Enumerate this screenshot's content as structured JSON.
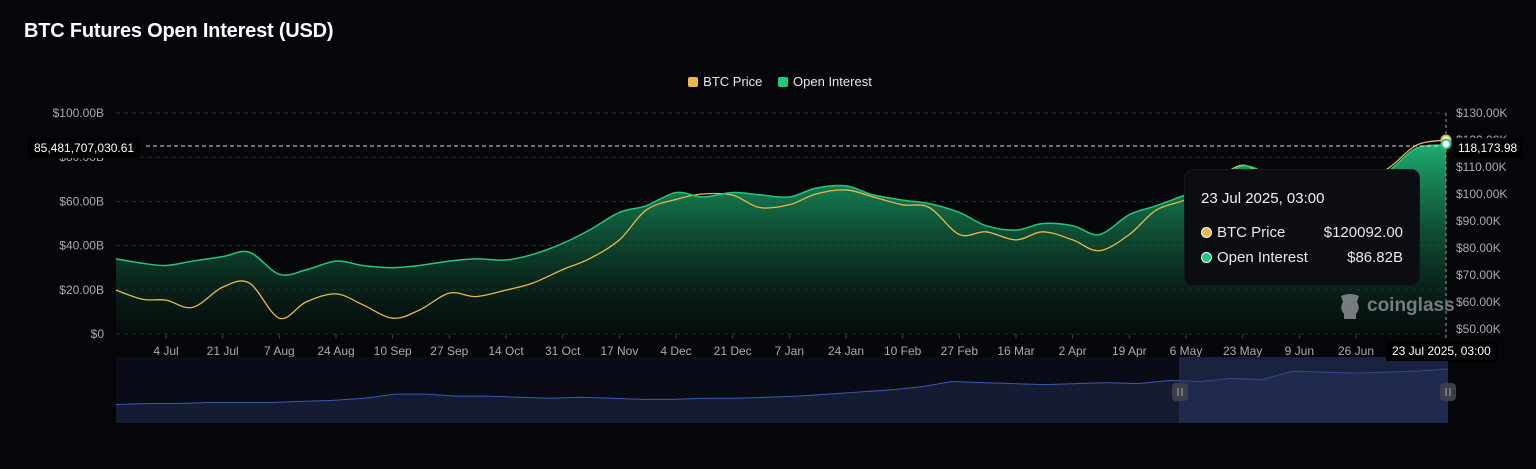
{
  "title": "BTC Futures Open Interest (USD)",
  "legend": [
    {
      "name": "BTC Price",
      "color": "#e8b84a"
    },
    {
      "name": "Open Interest",
      "color": "#21c77f"
    }
  ],
  "tooltip": {
    "date": "23 Jul 2025, 03:00",
    "rows": [
      {
        "name": "BTC Price",
        "value": "$120092.00",
        "color": "#e8b84a"
      },
      {
        "name": "Open Interest",
        "value": "$86.82B",
        "color": "#21c77f"
      }
    ]
  },
  "crosshair": {
    "left_value": "85,481,707,030.61",
    "right_value": "118,173.98",
    "x_label": "23 Jul 2025, 03:00"
  },
  "watermark": "coinglass",
  "chart_data": {
    "type": "line",
    "title": "BTC Futures Open Interest (USD)",
    "x": [
      "2024-06-19",
      "2024-06-27",
      "2024-07-04",
      "2024-07-12",
      "2024-07-21",
      "2024-07-29",
      "2024-08-07",
      "2024-08-15",
      "2024-08-24",
      "2024-09-01",
      "2024-09-10",
      "2024-09-18",
      "2024-09-27",
      "2024-10-05",
      "2024-10-14",
      "2024-10-22",
      "2024-10-31",
      "2024-11-08",
      "2024-11-17",
      "2024-11-25",
      "2024-12-04",
      "2024-12-12",
      "2024-12-21",
      "2024-12-29",
      "2025-01-07",
      "2025-01-15",
      "2025-01-24",
      "2025-02-01",
      "2025-02-10",
      "2025-02-18",
      "2025-02-27",
      "2025-03-07",
      "2025-03-16",
      "2025-03-24",
      "2025-04-02",
      "2025-04-10",
      "2025-04-19",
      "2025-04-27",
      "2025-05-06",
      "2025-05-14",
      "2025-05-23",
      "2025-06-01",
      "2025-06-09",
      "2025-06-17",
      "2025-06-26",
      "2025-07-05",
      "2025-07-14",
      "2025-07-23"
    ],
    "series": [
      {
        "name": "Open Interest",
        "axis": "left",
        "color": "#21c77f",
        "values": [
          34,
          32,
          31,
          33,
          35,
          37,
          27,
          29,
          33,
          31,
          30,
          31,
          33,
          34,
          33.5,
          36,
          41,
          47,
          55,
          58,
          64,
          62,
          64,
          63,
          62,
          66,
          67,
          63,
          60.6,
          59,
          55,
          49,
          47,
          50,
          49,
          45,
          54,
          58,
          63,
          67,
          76,
          72,
          74,
          71,
          70,
          73,
          84,
          85.5
        ]
      },
      {
        "name": "BTC Price",
        "axis": "right",
        "color": "#e8b84a",
        "values": [
          64.4,
          61,
          60.7,
          58,
          65.5,
          67,
          54,
          60,
          63,
          59,
          54,
          57,
          63.3,
          62,
          64.4,
          67,
          72,
          76,
          83,
          94,
          98,
          100,
          99.6,
          95,
          96,
          100,
          101.5,
          99,
          96,
          95,
          85,
          86,
          83,
          86,
          83,
          79,
          85,
          94,
          98,
          104,
          110.7,
          105,
          109,
          104,
          107,
          109,
          118,
          120
        ]
      }
    ],
    "x_ticks": [
      "4 Jul",
      "21 Jul",
      "7 Aug",
      "24 Aug",
      "10 Sep",
      "27 Sep",
      "14 Oct",
      "31 Oct",
      "17 Nov",
      "4 Dec",
      "21 Dec",
      "7 Jan",
      "24 Jan",
      "10 Feb",
      "27 Feb",
      "16 Mar",
      "2 Apr",
      "19 Apr",
      "6 May",
      "23 May",
      "9 Jun",
      "26 Jun"
    ],
    "y_left": {
      "ticks": [
        "$0",
        "$20.00B",
        "$40.00B",
        "$60.00B",
        "$80.00B",
        "$100.00B"
      ],
      "range": [
        0,
        100
      ],
      "unit": "B USD"
    },
    "y_right": {
      "ticks": [
        "$50.00K",
        "$60.00K",
        "$70.00K",
        "$80.00K",
        "$90.00K",
        "$100.00K",
        "$110.00K",
        "$120.00K",
        "$130.00K"
      ],
      "range": [
        50,
        130
      ],
      "unit": "K USD"
    },
    "grid": true,
    "legend_position": "top-center",
    "navigator_values": [
      10,
      11,
      11,
      12,
      12,
      12,
      13,
      14,
      16,
      20,
      20,
      18,
      18,
      17,
      16,
      17,
      16,
      15,
      15,
      16,
      16,
      17,
      18,
      20,
      22,
      24,
      27,
      32,
      31,
      30,
      29,
      30,
      31,
      30,
      33,
      32,
      35,
      34,
      42,
      41,
      40,
      41,
      42,
      44
    ]
  }
}
